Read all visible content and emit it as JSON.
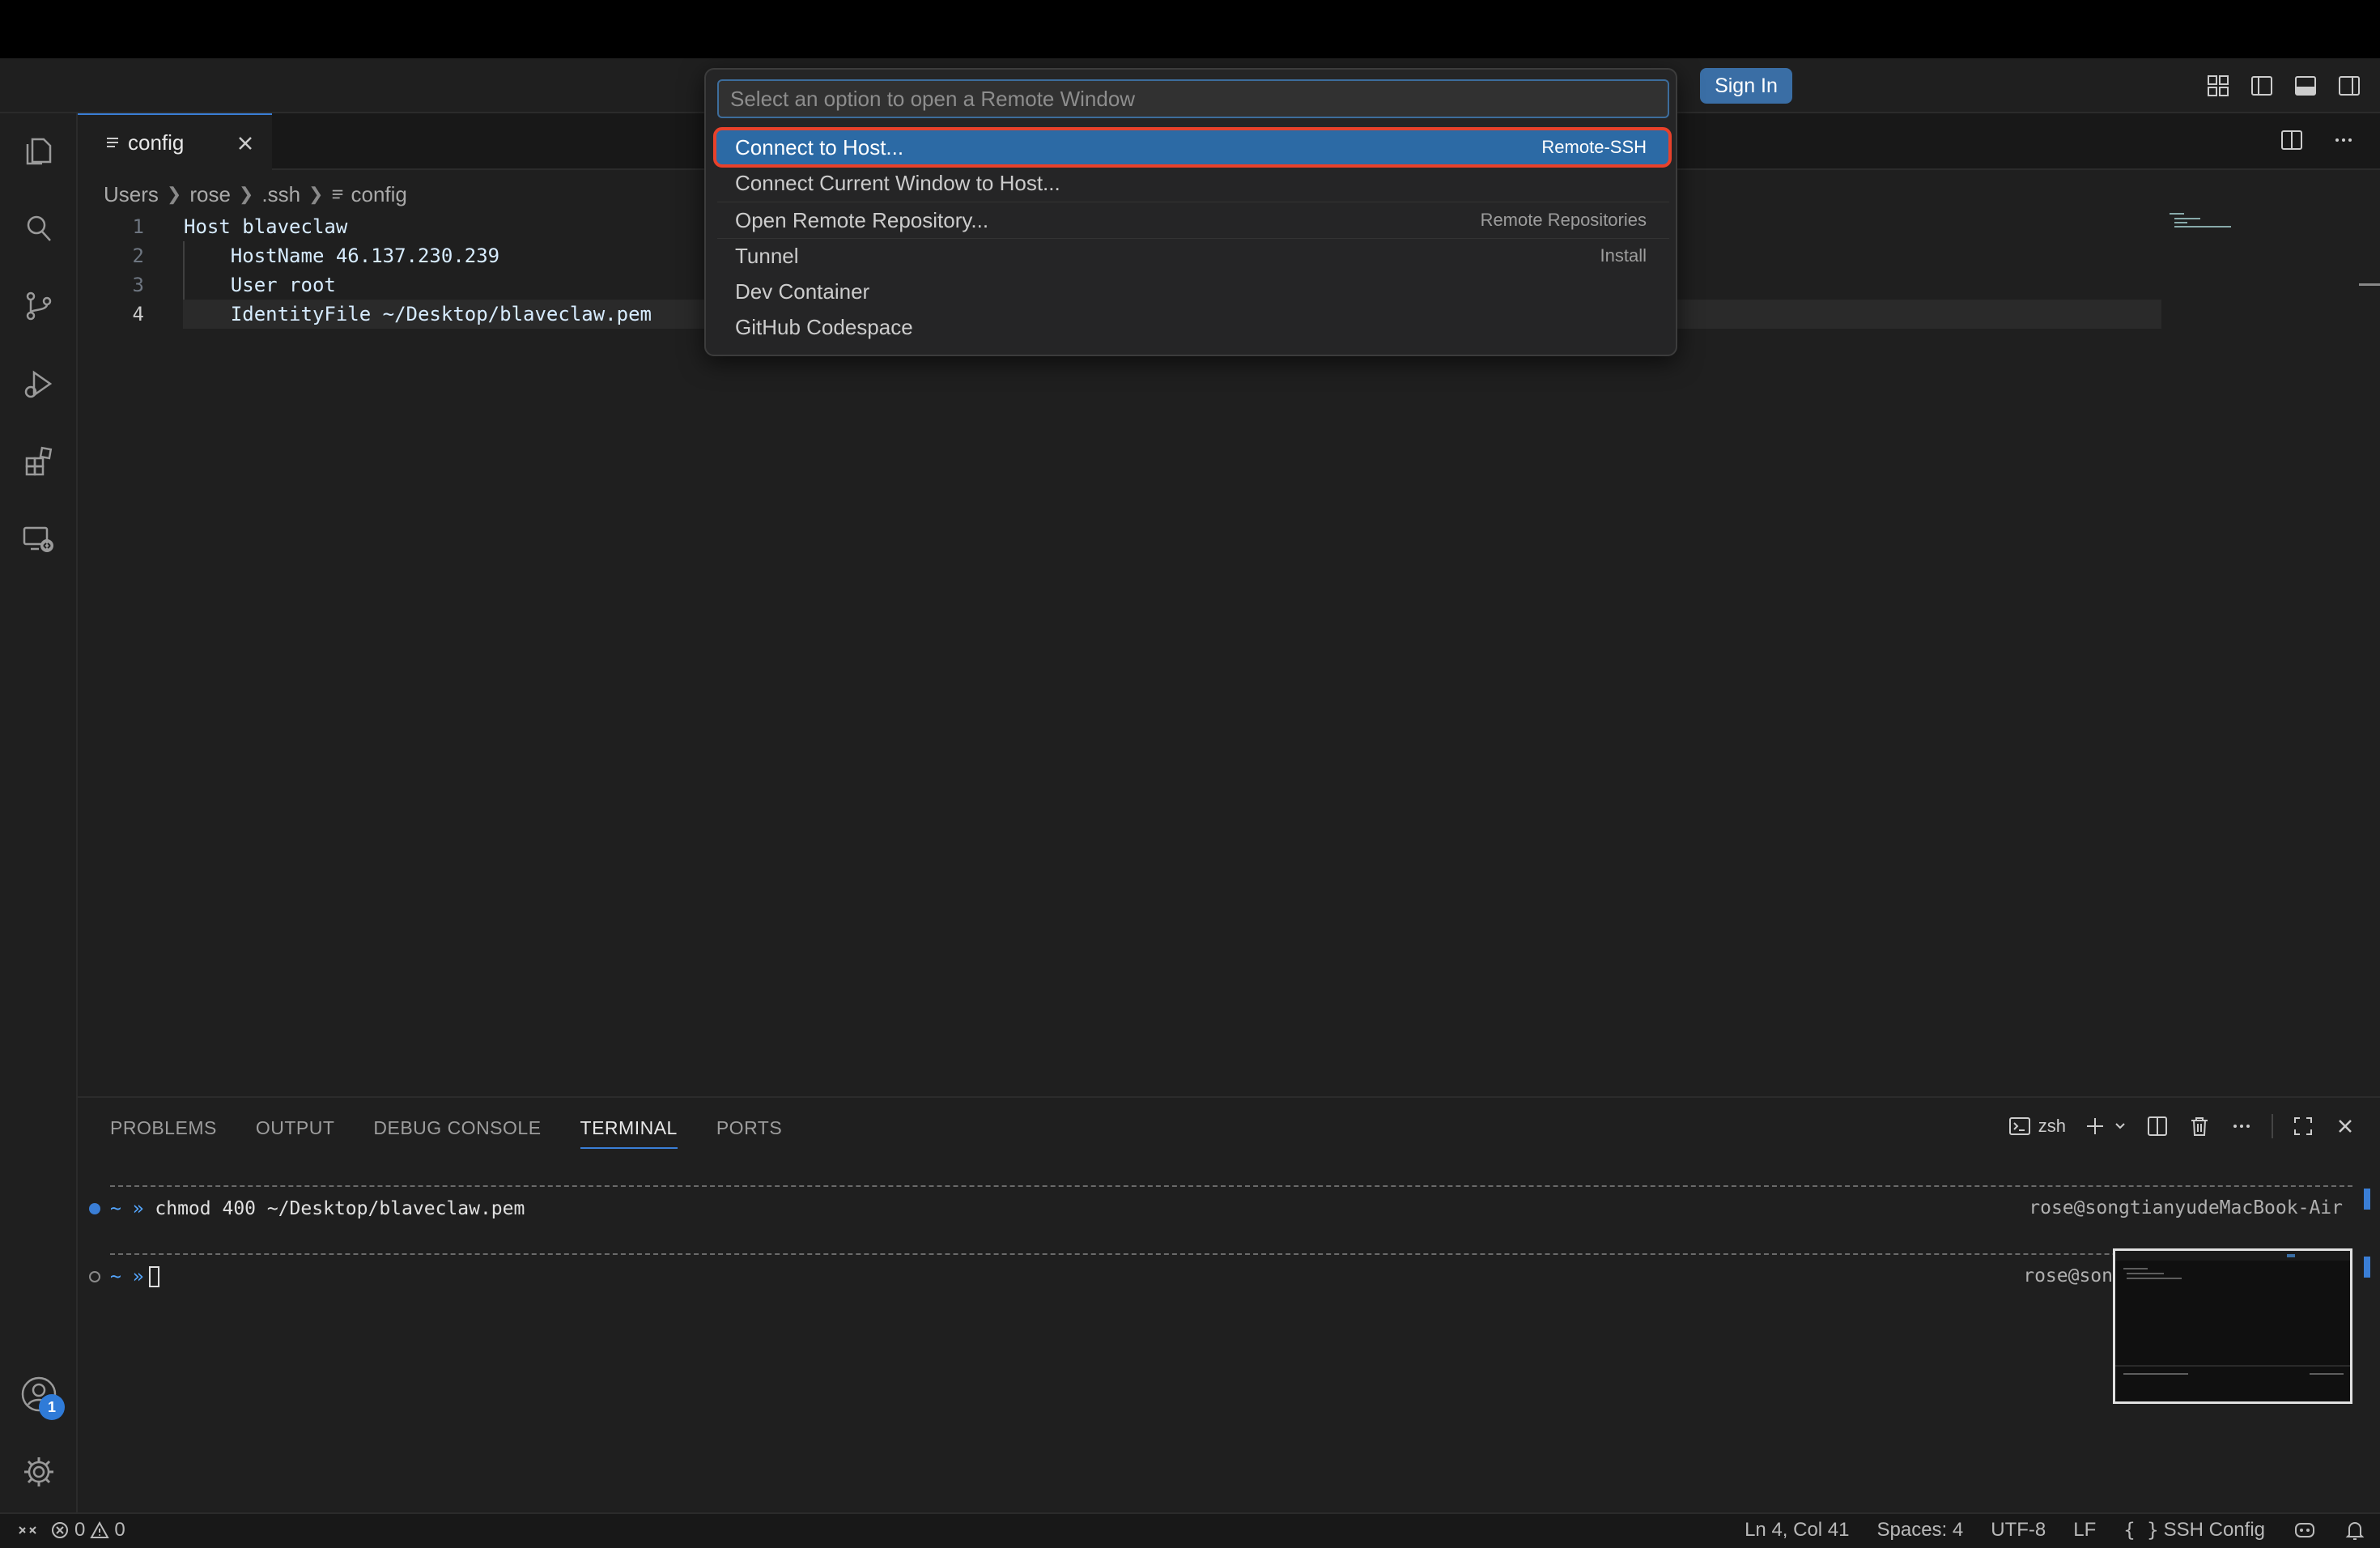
{
  "quick_pick": {
    "placeholder": "Select an option to open a Remote Window",
    "items": [
      {
        "label": "Connect to Host...",
        "description": "Remote-SSH"
      },
      {
        "label": "Connect Current Window to Host...",
        "description": ""
      },
      {
        "label": "Open Remote Repository...",
        "description": "Remote Repositories"
      },
      {
        "label": "Tunnel",
        "description": "Install"
      },
      {
        "label": "Dev Container",
        "description": ""
      },
      {
        "label": "GitHub Codespace",
        "description": ""
      }
    ]
  },
  "titlebar": {
    "sign_in_label": "Sign In"
  },
  "tab": {
    "name": "config"
  },
  "breadcrumb": [
    "Users",
    "rose",
    ".ssh",
    "config"
  ],
  "code": {
    "line_numbers": [
      "1",
      "2",
      "3",
      "4"
    ],
    "lines": [
      "Host blaveclaw",
      "    HostName 46.137.230.239",
      "    User root",
      "    IdentityFile ~/Desktop/blaveclaw.pem"
    ]
  },
  "activity": {
    "accounts_badge": "1"
  },
  "panel": {
    "tabs": [
      "PROBLEMS",
      "OUTPUT",
      "DEBUG CONSOLE",
      "TERMINAL",
      "PORTS"
    ],
    "active_tab": "TERMINAL",
    "shell": "zsh"
  },
  "terminal": {
    "prompt": "~ »",
    "command": " chmod 400 ~/Desktop/blaveclaw.pem",
    "right_prompt_1": "rose@songtianyudeMacBook-Air",
    "right_prompt_2": "rose@son"
  },
  "statusbar": {
    "errors": "0",
    "warnings": "0",
    "position": "Ln 4, Col 41",
    "spaces": "Spaces: 4",
    "encoding": "UTF-8",
    "eol": "LF",
    "language": "SSH Config"
  },
  "colors": {
    "accent": "#2c6aa5",
    "highlight_outline": "#e8412b",
    "sign_in": "#3a6ea5",
    "code_text": "#d7ecff"
  }
}
